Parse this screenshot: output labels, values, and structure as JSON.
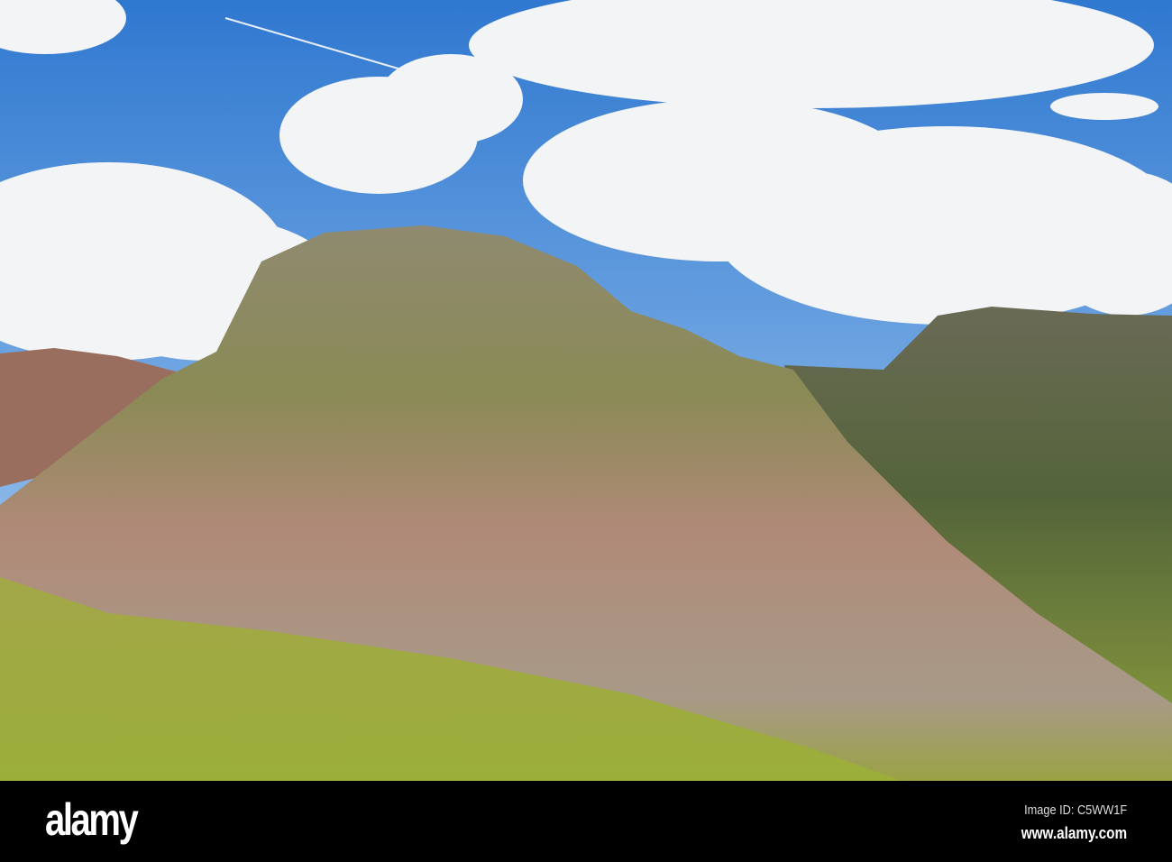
{
  "photo": {
    "subject": "mountain-landscape",
    "colors": {
      "sky": "#3f86d6",
      "cloud": "#f4f5f7",
      "rock": "#a98a78",
      "grass": "#9aa83a",
      "shadow": "#4f5a3a"
    }
  },
  "watermark": {
    "logo": "alamy",
    "image_id": "Image ID: C5WW1F",
    "url": "www.alamy.com"
  }
}
